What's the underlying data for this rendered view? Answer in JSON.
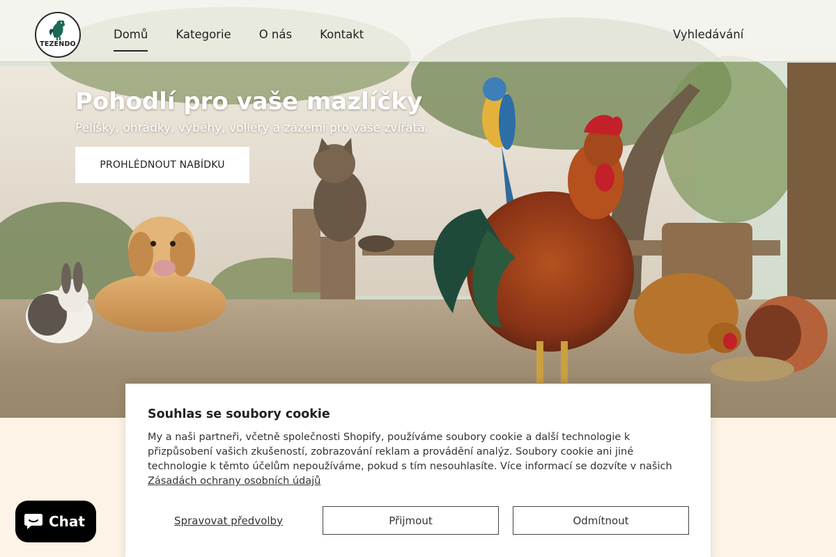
{
  "brand": {
    "logo_text": "TEZENDO"
  },
  "nav": {
    "items": [
      {
        "label": "Domů",
        "active": true
      },
      {
        "label": "Kategorie",
        "active": false
      },
      {
        "label": "O nás",
        "active": false
      },
      {
        "label": "Kontakt",
        "active": false
      }
    ],
    "search_label": "Vyhledávání"
  },
  "hero": {
    "title": "Pohodlí pro vaše mazlíčky",
    "subtitle": "Pelíšky, ohrádky, výběhy, voliéry a zázemí pro vaše zvířata.",
    "cta_label": "PROHLÉDNOUT NABÍDKU"
  },
  "cookie": {
    "title": "Souhlas se soubory cookie",
    "text": "My a naši partneři, včetně společnosti Shopify, používáme soubory cookie a další technologie k přizpůsobení vašich zkušeností, zobrazování reklam a provádění analýz. Soubory cookie ani jiné technologie k těmto účelům nepoužíváme, pokud s tím nesouhlasíte. Více informací se dozvíte v našich ",
    "link_text": "Zásadách ochrany osobních údajů",
    "manage_label": "Spravovat předvolby",
    "accept_label": "Přijmout",
    "decline_label": "Odmítnout"
  },
  "chat": {
    "label": "Chat",
    "icon": "chat-bubble-icon"
  },
  "colors": {
    "page_bg": "#fdf3e6",
    "chat_bg": "#000000",
    "header_bg": "#f8f6f0"
  }
}
